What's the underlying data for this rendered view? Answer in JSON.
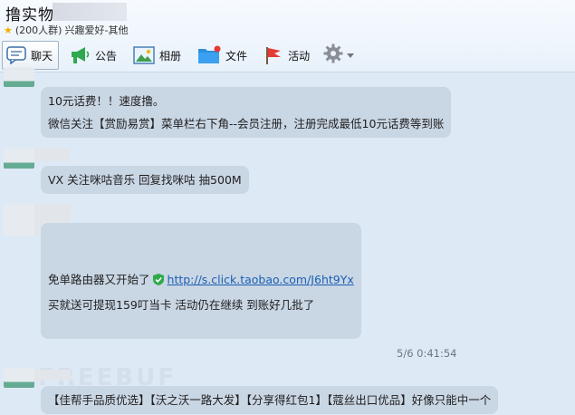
{
  "header": {
    "group_name": "撸实物",
    "member_count": "(200人群)",
    "category": "兴趣爱好-其他"
  },
  "toolbar": {
    "items": [
      {
        "label": "聊天",
        "icon": "chat-icon",
        "active": true
      },
      {
        "label": "公告",
        "icon": "announcement-icon"
      },
      {
        "label": "相册",
        "icon": "album-icon"
      },
      {
        "label": "文件",
        "icon": "folder-icon"
      },
      {
        "label": "活动",
        "icon": "flag-icon"
      }
    ],
    "settings_icon": "gear-icon"
  },
  "messages": [
    {
      "lines": [
        "10元话费！！速度撸。",
        "微信关注【赏励易赏】菜单栏右下角--会员注册，注册完成最低10元话费等到账"
      ]
    },
    {
      "lines": [
        "VX 关注咪咕音乐 回复找咪咕 抽500M"
      ]
    },
    {
      "line1_text": "免单路由器又开始了",
      "link": "http://s.click.taobao.com/J6ht9Yx",
      "line2": "买就送可提现159叮当卡 活动仍在继续  到账好几批了",
      "timestamp": "5/6 0:41:54"
    },
    {
      "lines": [
        "【佳帮手品质优选】【沃之沃一路大发】【分享得红包1】【蔻丝出口优品】好像只能中一个"
      ]
    }
  ],
  "colors": {
    "bubble": "#c9d6e4",
    "background": "#dde9f5",
    "link": "#1a5fb4"
  }
}
